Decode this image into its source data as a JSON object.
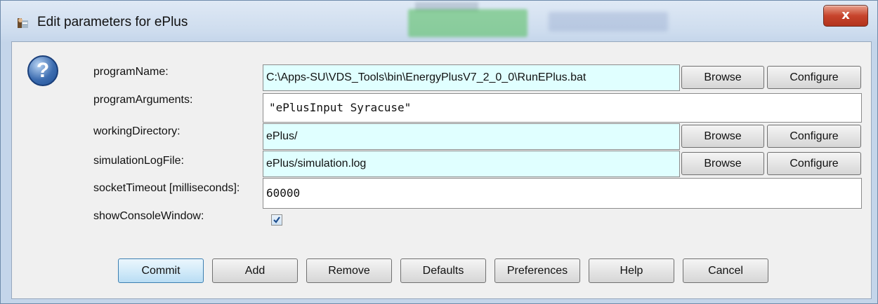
{
  "window": {
    "title": "Edit parameters for ePlus",
    "close_label": "x"
  },
  "params": {
    "programName": {
      "label": "programName:",
      "value": "C:\\Apps-SU\\VDS_Tools\\bin\\EnergyPlusV7_2_0_0\\RunEPlus.bat",
      "browse": "Browse",
      "configure": "Configure"
    },
    "programArguments": {
      "label": "programArguments:",
      "value": "\"ePlusInput Syracuse\""
    },
    "workingDirectory": {
      "label": "workingDirectory:",
      "value": "ePlus/",
      "browse": "Browse",
      "configure": "Configure"
    },
    "simulationLogFile": {
      "label": "simulationLogFile:",
      "value": "ePlus/simulation.log",
      "browse": "Browse",
      "configure": "Configure"
    },
    "socketTimeout": {
      "label": "socketTimeout [milliseconds]:",
      "value": "60000"
    },
    "showConsoleWindow": {
      "label": "showConsoleWindow:",
      "checked": true
    }
  },
  "buttons": {
    "commit": "Commit",
    "add": "Add",
    "remove": "Remove",
    "defaults": "Defaults",
    "preferences": "Preferences",
    "help": "Help",
    "cancel": "Cancel"
  },
  "icons": {
    "help": "question-icon",
    "app": "app-icon"
  },
  "colors": {
    "field_background": "#e0ffff",
    "close_button": "#c7442c"
  }
}
